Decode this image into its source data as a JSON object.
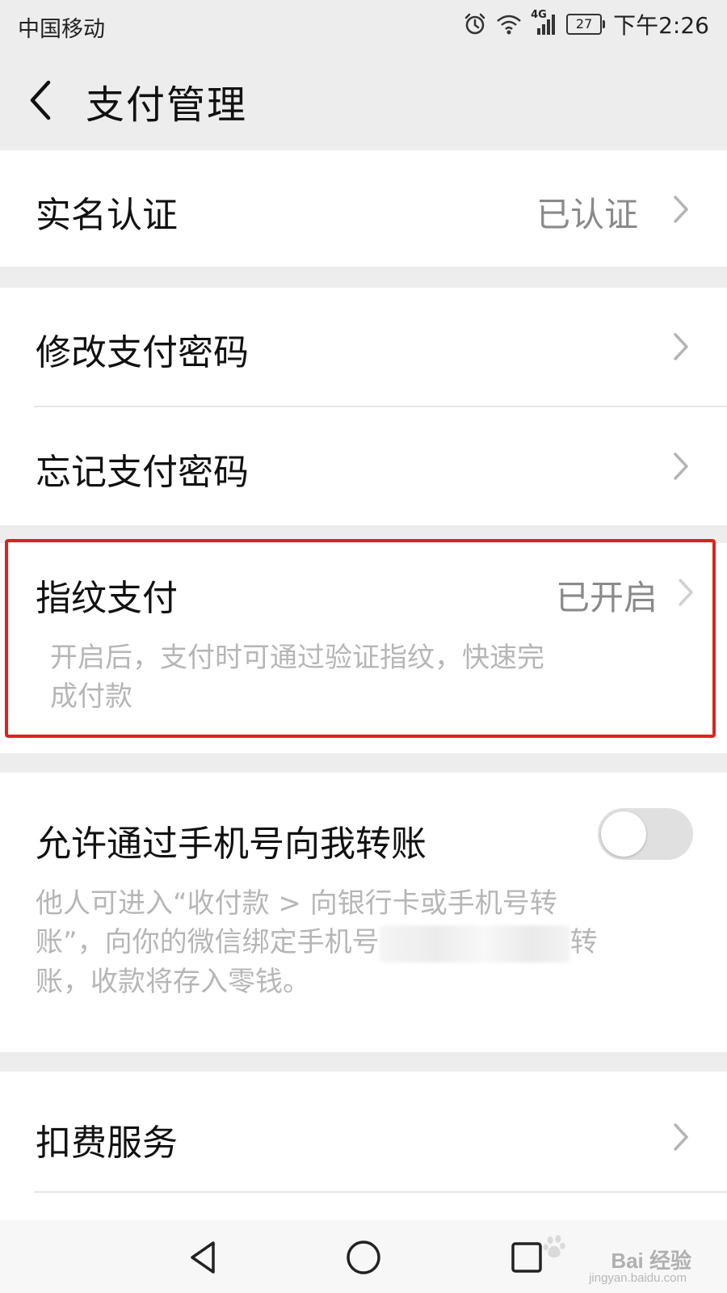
{
  "status_bar": {
    "carrier": "中国移动",
    "network": "4G",
    "battery": "27",
    "time": "下午2:26",
    "icons": [
      "alarm-icon",
      "wifi-icon",
      "signal-icon",
      "battery-icon"
    ]
  },
  "header": {
    "back_icon": "chevron-left-icon",
    "title": "支付管理"
  },
  "groups": {
    "identity": {
      "label": "实名认证",
      "value": "已认证"
    },
    "password": {
      "change_label": "修改支付密码",
      "forgot_label": "忘记支付密码"
    },
    "fingerprint": {
      "label": "指纹支付",
      "value": "已开启",
      "desc_line1": "开启后，支付时可通过验证指纹，快速完",
      "desc_line2": "成付款"
    },
    "phone_transfer": {
      "label": "允许通过手机号向我转账",
      "toggle_on": false,
      "desc_line1": "他人可进入“收付款 > 向银行卡或手机号转",
      "desc_line2_before": "账”，向你的微信绑定手机号",
      "desc_line2_after": "转",
      "desc_line3": "账，收款将存入零钱。"
    },
    "deduction": {
      "label": "扣费服务"
    }
  },
  "nav_bar": {
    "back_icon": "triangle-back-icon",
    "home_icon": "circle-home-icon",
    "recents_icon": "square-recents-icon"
  },
  "watermark": {
    "text": "Bai 经验",
    "sub": "jingyan.baidu.com"
  },
  "colors": {
    "background": "#ededed",
    "card": "#ffffff",
    "highlight": "#e02020",
    "value_text": "#8a8a8a",
    "desc_text": "#b6b6b6"
  }
}
